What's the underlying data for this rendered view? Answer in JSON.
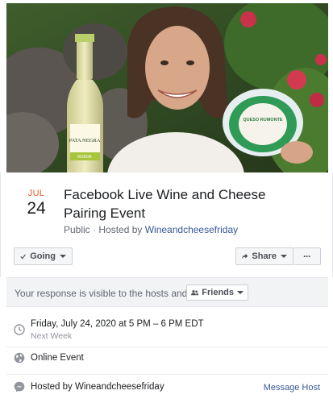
{
  "event": {
    "month": "JUL",
    "day": "24",
    "title": "Facebook Live Wine and Cheese Pairing Event",
    "privacy": "Public · Hosted by ",
    "host_link": "Wineandcheesefriday"
  },
  "actions": {
    "going_label": "Going",
    "share_label": "Share",
    "more_label": "···"
  },
  "visibility": {
    "text": "Your response is visible to the hosts and",
    "audience_label": "Friends"
  },
  "details": {
    "datetime": "Friday, July 24, 2020 at 5 PM – 6 PM EDT",
    "relative": "Next Week",
    "location": "Online Event",
    "hosted_by": "Hosted by Wineandcheesefriday",
    "message_host": "Message Host"
  },
  "cover_image": {
    "bottle_label_brand": "PATA NEGRA",
    "bottle_label_variety": "RUEDA",
    "cheese_label_brand": "QUESO RUMONTE"
  },
  "colors": {
    "accent_date": "#e4572e",
    "link": "#385898",
    "text_secondary": "#606770"
  }
}
